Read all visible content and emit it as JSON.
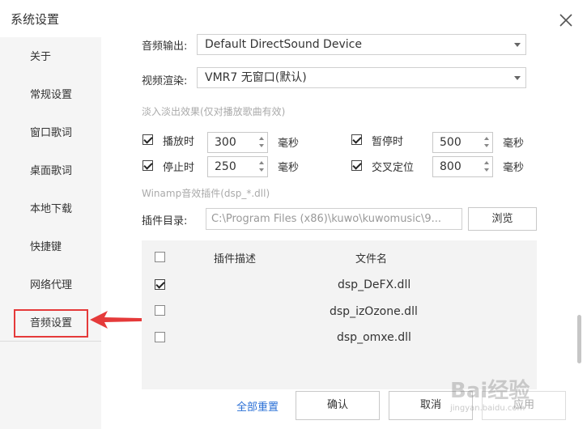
{
  "window": {
    "title": "系统设置",
    "close_icon": "close-icon"
  },
  "sidebar": {
    "items": [
      {
        "label": "关于"
      },
      {
        "label": "常规设置"
      },
      {
        "label": "窗口歌词"
      },
      {
        "label": "桌面歌词"
      },
      {
        "label": "本地下载"
      },
      {
        "label": "快捷键"
      },
      {
        "label": "网络代理"
      },
      {
        "label": "音频设置"
      }
    ],
    "selected": "音频设置",
    "highlight_color": "#e53a3a"
  },
  "audio": {
    "output_label": "音频输出:",
    "output_value": "Default DirectSound Device",
    "render_label": "视频渲染:",
    "render_value": "VMR7 无窗口(默认)",
    "fade_hint": "淡入淡出效果(仅对播放歌曲有效)",
    "play": {
      "label": "播放时",
      "value": "300",
      "unit": "毫秒",
      "checked": true
    },
    "stop": {
      "label": "停止时",
      "value": "250",
      "unit": "毫秒",
      "checked": true
    },
    "pause": {
      "label": "暂停时",
      "value": "500",
      "unit": "毫秒",
      "checked": true
    },
    "crossfade": {
      "label": "交叉定位",
      "value": "800",
      "unit": "毫秒",
      "checked": true
    },
    "winamp_hint": "Winamp音效插件(dsp_*.dll)",
    "plugin_dir_label": "插件目录:",
    "plugin_dir_value": "C:\\Program  Files  (x86)\\kuwo\\kuwomusic\\9...",
    "browse_label": "浏览"
  },
  "plugins": {
    "headers": {
      "desc": "插件描述",
      "file": "文件名"
    },
    "rows": [
      {
        "file": "dsp_DeFX.dll",
        "checked": true
      },
      {
        "file": "dsp_izOzone.dll",
        "checked": false
      },
      {
        "file": "dsp_omxe.dll",
        "checked": false
      }
    ]
  },
  "footer": {
    "reset_label": "全部重置",
    "ok_label": "确认",
    "cancel_label": "取消",
    "apply_label": "应用"
  },
  "watermark": {
    "text": "Bai经验",
    "sub": "jingyan.baidu.com"
  }
}
